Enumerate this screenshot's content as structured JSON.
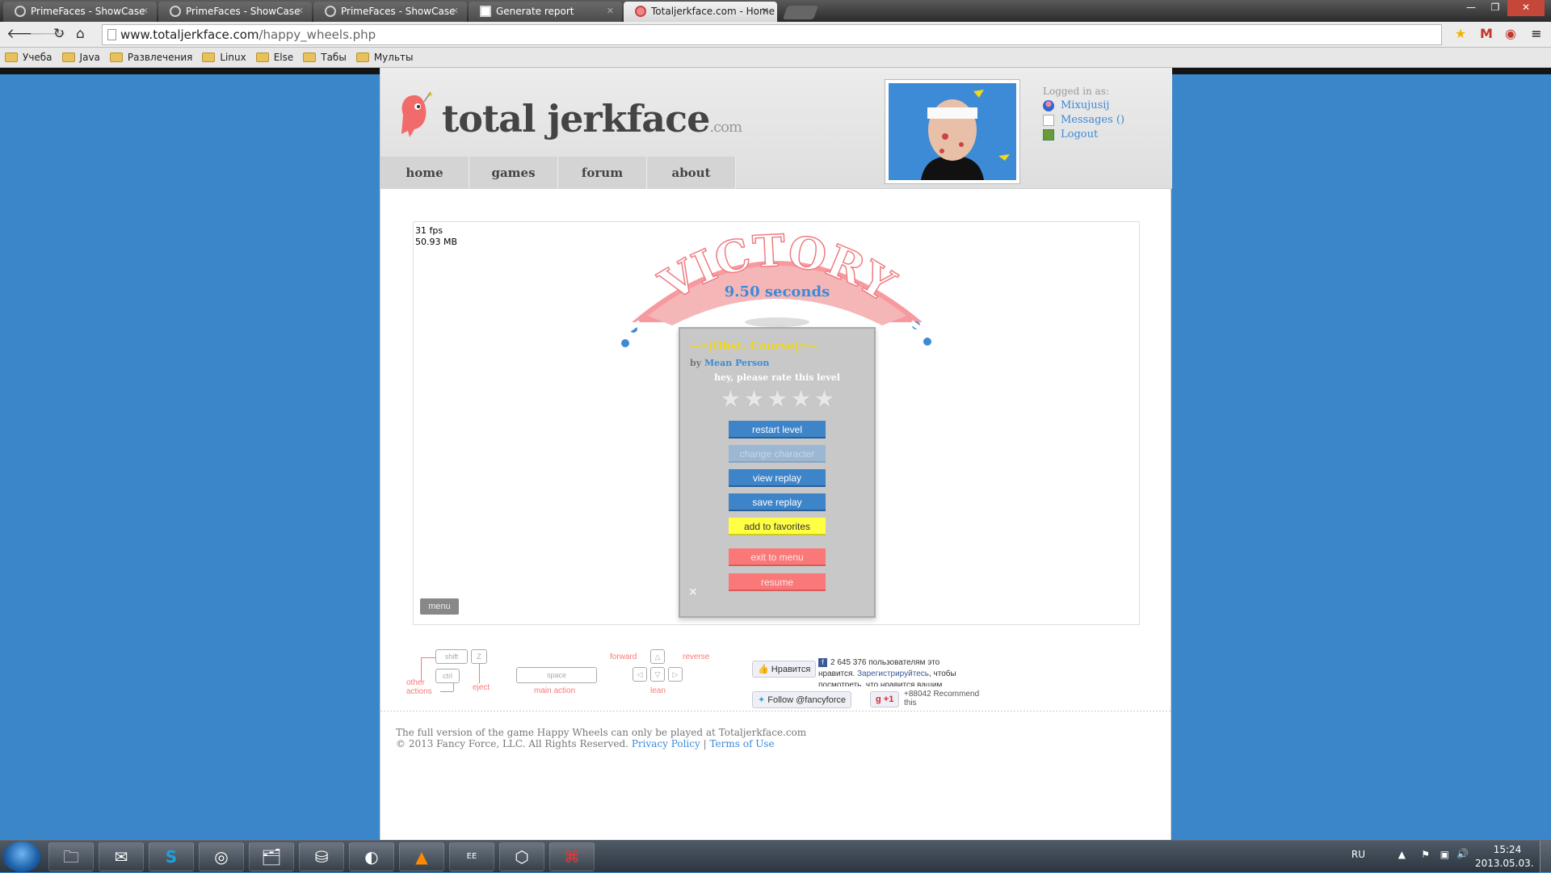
{
  "browser": {
    "tabs": [
      {
        "title": "PrimeFaces - ShowCase",
        "active": false
      },
      {
        "title": "PrimeFaces - ShowCase",
        "active": false
      },
      {
        "title": "PrimeFaces - ShowCase",
        "active": false
      },
      {
        "title": "Generate report",
        "active": false
      },
      {
        "title": "Totaljerkface.com - Home",
        "active": true
      }
    ],
    "url_host": "www.totaljerkface.com",
    "url_path": "/happy_wheels.php",
    "bookmarks": [
      "Учеба",
      "Java",
      "Развлечения",
      "Linux",
      "Else",
      "Табы",
      "Мульты"
    ]
  },
  "site": {
    "logo_text": "total jerkface",
    "logo_suffix": ".com",
    "nav": [
      "home",
      "games",
      "forum",
      "about"
    ],
    "user": {
      "logged_in_label": "Logged in as:",
      "username": "Mixujusij",
      "messages": "Messages ()",
      "logout": "Logout"
    }
  },
  "game": {
    "fps": "31 fps",
    "memory": "50.93 MB",
    "banner": "VICTORY",
    "time": "9.50 seconds",
    "level_title": "--=|Obst. Course|=--",
    "by_label": "by",
    "author": "Mean Person",
    "rate_prompt": "hey, please rate this level",
    "rating": 0,
    "rating_max": 5,
    "buttons": {
      "restart": "restart level",
      "change_character": "change character",
      "view_replay": "view replay",
      "save_replay": "save replay",
      "add_favorites": "add to favorites",
      "exit_menu": "exit to menu",
      "resume": "resume"
    },
    "menu_label": "menu"
  },
  "controls": {
    "keys": {
      "shift": "shift",
      "z": "Z",
      "ctrl": "ctrl",
      "space": "space"
    },
    "labels": {
      "other_actions": "other\nactions",
      "eject": "eject",
      "main_action": "main action",
      "forward": "forward",
      "reverse": "reverse",
      "lean": "lean"
    }
  },
  "social": {
    "like": "Нравится",
    "fb_count": "2 645 376 пользователям это нравится.",
    "fb_link": "Зарегистрируйтесь",
    "fb_rest": ", чтобы посмотреть, что нравится вашим друзьям.",
    "follow": "Follow @fancyforce",
    "gplus": "+1",
    "gplus_count": "+88042",
    "recommend": "Recommend this"
  },
  "footer": {
    "line1": "The full version of the game Happy Wheels can only be played at Totaljerkface.com",
    "line2": "© 2013 Fancy Force, LLC. All Rights Reserved.",
    "privacy": "Privacy Policy",
    "sep": "|",
    "terms": "Terms of Use"
  },
  "taskbar": {
    "apps": [
      "explorer-icon",
      "outlook-icon",
      "skype-icon",
      "chrome-icon",
      "folder-share-icon",
      "database-icon",
      "eclipse-icon",
      "vlc-icon",
      "java-ee-icon",
      "virtualbox-icon",
      "acrobat-icon"
    ],
    "lang": "RU",
    "time": "15:24",
    "date": "2013.05.03."
  }
}
